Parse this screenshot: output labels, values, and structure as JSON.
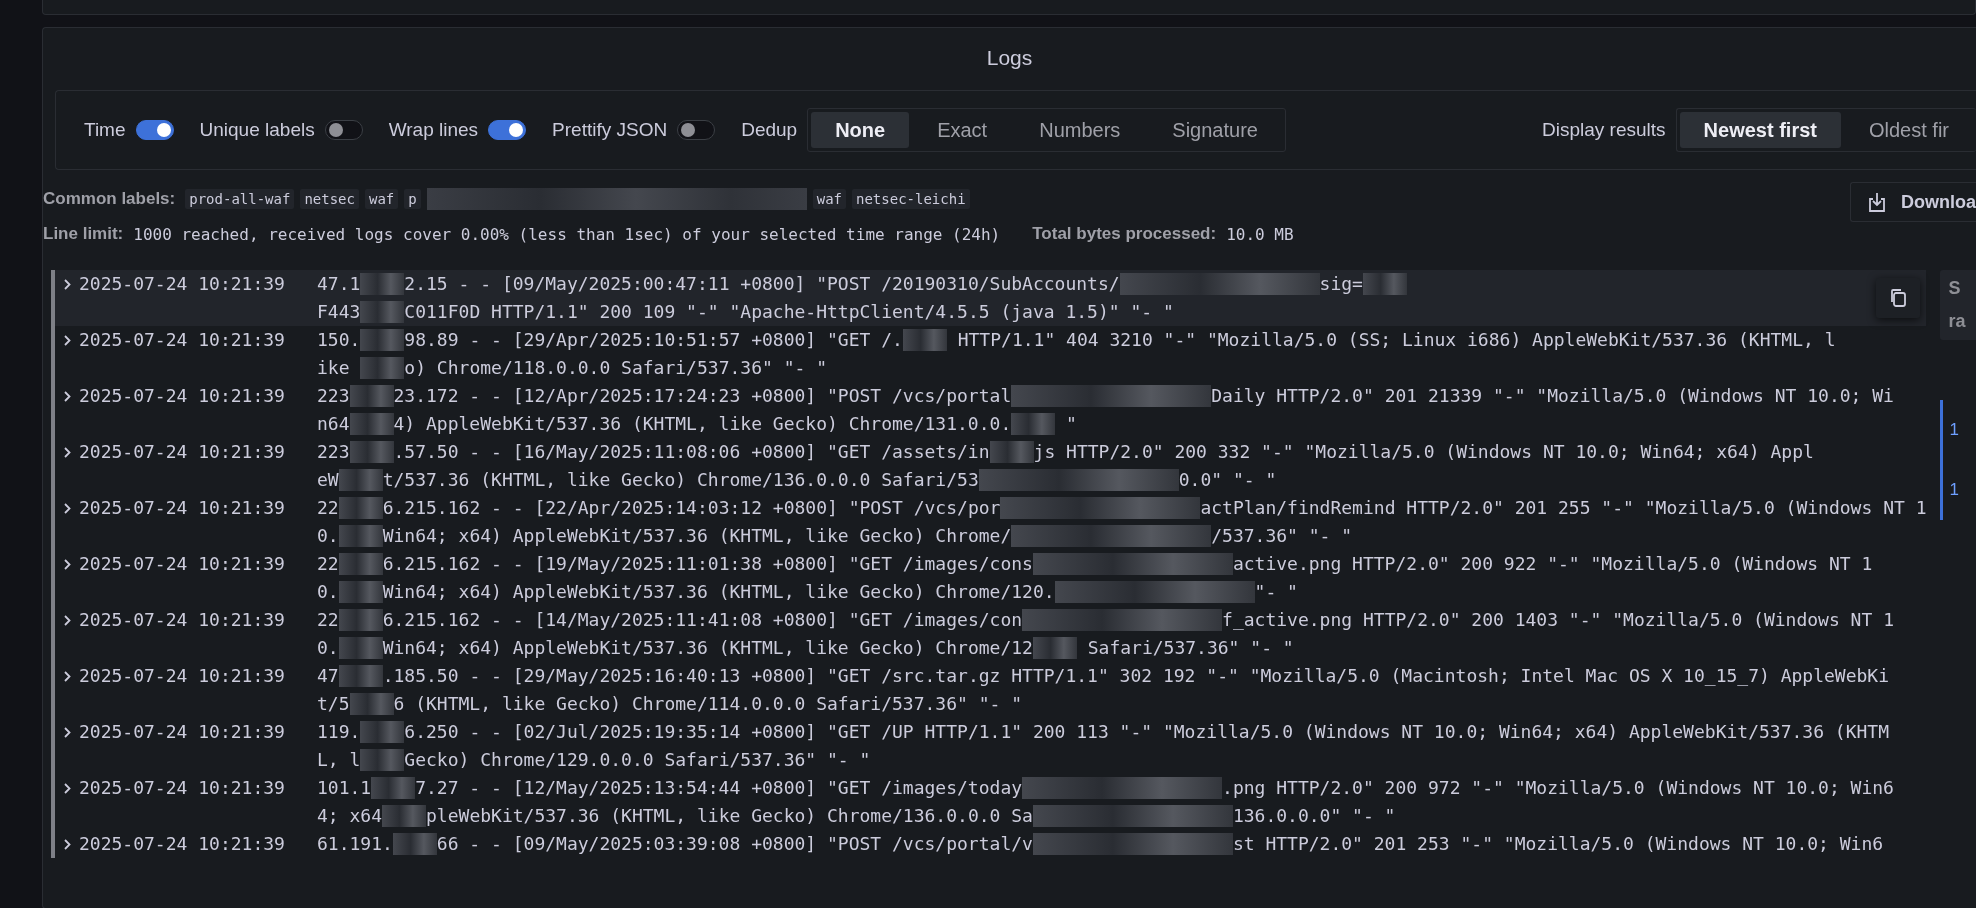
{
  "panel": {
    "title": "Logs"
  },
  "toggles": [
    {
      "label": "Time",
      "on": true
    },
    {
      "label": "Unique labels",
      "on": false
    },
    {
      "label": "Wrap lines",
      "on": true
    },
    {
      "label": "Prettify JSON",
      "on": false
    }
  ],
  "dedup": {
    "label": "Dedup",
    "options": [
      {
        "label": "None",
        "selected": true
      },
      {
        "label": "Exact",
        "selected": false
      },
      {
        "label": "Numbers",
        "selected": false
      },
      {
        "label": "Signature",
        "selected": false
      }
    ]
  },
  "display_results": {
    "label": "Display results",
    "options": [
      {
        "label": "Newest first",
        "selected": true
      },
      {
        "label": "Oldest fir",
        "selected": false
      }
    ]
  },
  "common_labels": {
    "label": "Common labels:",
    "items": [
      {
        "kind": "chip",
        "text": "prod-all-waf"
      },
      {
        "kind": "chip",
        "text": "netsec"
      },
      {
        "kind": "chip",
        "text": "waf"
      },
      {
        "kind": "chip",
        "text": "p"
      },
      {
        "kind": "wide-blur"
      },
      {
        "kind": "chip",
        "text": "waf"
      },
      {
        "kind": "chip",
        "text": "netsec-leichi"
      }
    ]
  },
  "line_limit": {
    "label": "Line limit:",
    "text": "1000 reached, received logs cover 0.00% (less than 1sec) of your selected time range (24h)"
  },
  "bytes": {
    "label": "Total bytes processed:",
    "value": "10.0 MB"
  },
  "download": {
    "label": "Downloa"
  },
  "logs": [
    {
      "time": "2025-07-24 10:21:39",
      "hovered": true,
      "lines": [
        [
          {
            "kind": "text",
            "text": "47.1"
          },
          {
            "kind": "blur"
          },
          {
            "kind": "text",
            "text": "2.15 - - [09/May/2025:00:47:11 +0800] \"POST /20190310/SubAccounts/"
          },
          {
            "kind": "wide-blur"
          },
          {
            "kind": "text",
            "text": "sig="
          },
          {
            "kind": "blur"
          }
        ],
        [
          {
            "kind": "text",
            "text": "F443"
          },
          {
            "kind": "blur"
          },
          {
            "kind": "text",
            "text": "C011F0D HTTP/1.1\" 200 109 \"-\" \"Apache-HttpClient/4.5.5 (java 1.5)\" \"- \""
          }
        ]
      ]
    },
    {
      "time": "2025-07-24 10:21:39",
      "hovered": false,
      "lines": [
        [
          {
            "kind": "text",
            "text": "150."
          },
          {
            "kind": "blur"
          },
          {
            "kind": "text",
            "text": "98.89 - - [29/Apr/2025:10:51:57 +0800] \"GET /."
          },
          {
            "kind": "blur"
          },
          {
            "kind": "text",
            "text": " HTTP/1.1\" 404 3210 \"-\" \"Mozilla/5.0 (SS; Linux i686) AppleWebKit/537.36 (KHTML, l"
          }
        ],
        [
          {
            "kind": "text",
            "text": "ike "
          },
          {
            "kind": "blur"
          },
          {
            "kind": "text",
            "text": "o) Chrome/118.0.0.0 Safari/537.36\" \"- \""
          }
        ]
      ]
    },
    {
      "time": "2025-07-24 10:21:39",
      "hovered": false,
      "lines": [
        [
          {
            "kind": "text",
            "text": "223"
          },
          {
            "kind": "blur"
          },
          {
            "kind": "text",
            "text": "23.172 - - [12/Apr/2025:17:24:23 +0800] \"POST /vcs/portal"
          },
          {
            "kind": "wide-blur"
          },
          {
            "kind": "text",
            "text": "Daily HTTP/2.0\" 201 21339 \"-\" \"Mozilla/5.0 (Windows NT 10.0; Wi"
          }
        ],
        [
          {
            "kind": "text",
            "text": "n64"
          },
          {
            "kind": "blur"
          },
          {
            "kind": "text",
            "text": "4) AppleWebKit/537.36 (KHTML, like Gecko) Chrome/131.0.0."
          },
          {
            "kind": "blur"
          },
          {
            "kind": "text",
            "text": " \""
          }
        ]
      ]
    },
    {
      "time": "2025-07-24 10:21:39",
      "hovered": false,
      "lines": [
        [
          {
            "kind": "text",
            "text": "223"
          },
          {
            "kind": "blur"
          },
          {
            "kind": "text",
            "text": ".57.50 - - [16/May/2025:11:08:06 +0800] \"GET /assets/in"
          },
          {
            "kind": "blur"
          },
          {
            "kind": "text",
            "text": "js HTTP/2.0\" 200 332 \"-\" \"Mozilla/5.0 (Windows NT 10.0; Win64; x64) Appl"
          }
        ],
        [
          {
            "kind": "text",
            "text": "eW"
          },
          {
            "kind": "blur"
          },
          {
            "kind": "text",
            "text": "t/537.36 (KHTML, like Gecko) Chrome/136.0.0.0 Safari/53"
          },
          {
            "kind": "wide-blur"
          },
          {
            "kind": "text",
            "text": "0.0\" \"- \""
          }
        ]
      ]
    },
    {
      "time": "2025-07-24 10:21:39",
      "hovered": false,
      "lines": [
        [
          {
            "kind": "text",
            "text": "22"
          },
          {
            "kind": "blur"
          },
          {
            "kind": "text",
            "text": "6.215.162 - - [22/Apr/2025:14:03:12 +0800] \"POST /vcs/por"
          },
          {
            "kind": "wide-blur"
          },
          {
            "kind": "text",
            "text": "actPlan/findRemind HTTP/2.0\" 201 255 \"-\" \"Mozilla/5.0 (Windows NT 1"
          }
        ],
        [
          {
            "kind": "text",
            "text": "0."
          },
          {
            "kind": "blur"
          },
          {
            "kind": "text",
            "text": "Win64; x64) AppleWebKit/537.36 (KHTML, like Gecko) Chrome/"
          },
          {
            "kind": "wide-blur"
          },
          {
            "kind": "text",
            "text": "/537.36\" \"- \""
          }
        ]
      ]
    },
    {
      "time": "2025-07-24 10:21:39",
      "hovered": false,
      "lines": [
        [
          {
            "kind": "text",
            "text": "22"
          },
          {
            "kind": "blur"
          },
          {
            "kind": "text",
            "text": "6.215.162 - - [19/May/2025:11:01:38 +0800] \"GET /images/cons"
          },
          {
            "kind": "wide-blur"
          },
          {
            "kind": "text",
            "text": "active.png HTTP/2.0\" 200 922 \"-\" \"Mozilla/5.0 (Windows NT 1"
          }
        ],
        [
          {
            "kind": "text",
            "text": "0."
          },
          {
            "kind": "blur"
          },
          {
            "kind": "text",
            "text": "Win64; x64) AppleWebKit/537.36 (KHTML, like Gecko) Chrome/120."
          },
          {
            "kind": "wide-blur"
          },
          {
            "kind": "text",
            "text": "\"- \""
          }
        ]
      ]
    },
    {
      "time": "2025-07-24 10:21:39",
      "hovered": false,
      "lines": [
        [
          {
            "kind": "text",
            "text": "22"
          },
          {
            "kind": "blur"
          },
          {
            "kind": "text",
            "text": "6.215.162 - - [14/May/2025:11:41:08 +0800] \"GET /images/con"
          },
          {
            "kind": "wide-blur"
          },
          {
            "kind": "text",
            "text": "f_active.png HTTP/2.0\" 200 1403 \"-\" \"Mozilla/5.0 (Windows NT 1"
          }
        ],
        [
          {
            "kind": "text",
            "text": "0."
          },
          {
            "kind": "blur"
          },
          {
            "kind": "text",
            "text": "Win64; x64) AppleWebKit/537.36 (KHTML, like Gecko) Chrome/12"
          },
          {
            "kind": "blur"
          },
          {
            "kind": "text",
            "text": " Safari/537.36\" \"- \""
          }
        ]
      ]
    },
    {
      "time": "2025-07-24 10:21:39",
      "hovered": false,
      "lines": [
        [
          {
            "kind": "text",
            "text": "47"
          },
          {
            "kind": "blur"
          },
          {
            "kind": "text",
            "text": ".185.50 - - [29/May/2025:16:40:13 +0800] \"GET /src.tar.gz HTTP/1.1\" 302 192 \"-\" \"Mozilla/5.0 (Macintosh; Intel Mac OS X 10_15_7) AppleWebKi"
          }
        ],
        [
          {
            "kind": "text",
            "text": "t/5"
          },
          {
            "kind": "blur"
          },
          {
            "kind": "text",
            "text": "6 (KHTML, like Gecko) Chrome/114.0.0.0 Safari/537.36\" \"- \""
          }
        ]
      ]
    },
    {
      "time": "2025-07-24 10:21:39",
      "hovered": false,
      "lines": [
        [
          {
            "kind": "text",
            "text": "119."
          },
          {
            "kind": "blur"
          },
          {
            "kind": "text",
            "text": "6.250 - - [02/Jul/2025:19:35:14 +0800] \"GET /UP HTTP/1.1\" 200 113 \"-\" \"Mozilla/5.0 (Windows NT 10.0; Win64; x64) AppleWebKit/537.36 (KHTM"
          }
        ],
        [
          {
            "kind": "text",
            "text": "L, l"
          },
          {
            "kind": "blur"
          },
          {
            "kind": "text",
            "text": "Gecko) Chrome/129.0.0.0 Safari/537.36\" \"- \""
          }
        ]
      ]
    },
    {
      "time": "2025-07-24 10:21:39",
      "hovered": false,
      "lines": [
        [
          {
            "kind": "text",
            "text": "101.1"
          },
          {
            "kind": "blur"
          },
          {
            "kind": "text",
            "text": "7.27 - - [12/May/2025:13:54:44 +0800] \"GET /images/today"
          },
          {
            "kind": "wide-blur"
          },
          {
            "kind": "text",
            "text": ".png HTTP/2.0\" 200 972 \"-\" \"Mozilla/5.0 (Windows NT 10.0; Win6"
          }
        ],
        [
          {
            "kind": "text",
            "text": "4; x64"
          },
          {
            "kind": "blur"
          },
          {
            "kind": "text",
            "text": "pleWebKit/537.36 (KHTML, like Gecko) Chrome/136.0.0.0 Sa"
          },
          {
            "kind": "wide-blur"
          },
          {
            "kind": "text",
            "text": "136.0.0.0\" \"- \""
          }
        ]
      ]
    },
    {
      "time": "2025-07-24 10:21:39",
      "hovered": false,
      "lines": [
        [
          {
            "kind": "text",
            "text": "61.191."
          },
          {
            "kind": "blur"
          },
          {
            "kind": "text",
            "text": "66 - - [09/May/2025:03:39:08 +0800] \"POST /vcs/portal/v"
          },
          {
            "kind": "wide-blur"
          },
          {
            "kind": "text",
            "text": "st HTTP/2.0\" 201 253 \"-\" \"Mozilla/5.0 (Windows NT 10.0; Win6"
          }
        ]
      ]
    }
  ],
  "side": {
    "header": [
      "S",
      "ra"
    ],
    "markers": [
      "1",
      "1"
    ]
  }
}
